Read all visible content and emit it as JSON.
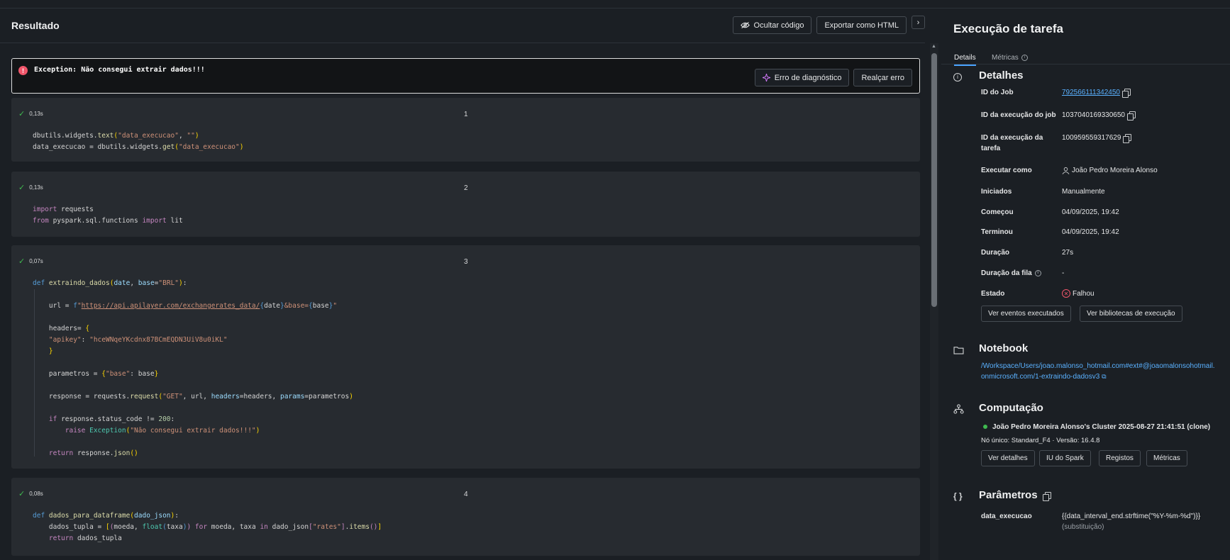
{
  "header": {
    "title": "Resultado",
    "hide_code": "Ocultar código",
    "export_html": "Exportar como HTML",
    "collapse": "›"
  },
  "error": {
    "icon": "!",
    "message": "Exception: Não consegui extrair dados!!!",
    "diagnose": "Erro de diagnóstico",
    "highlight": "Realçar erro"
  },
  "cells": [
    {
      "time": "0,13s",
      "num": "1"
    },
    {
      "time": "0,13s",
      "num": "2"
    },
    {
      "time": "0,07s",
      "num": "3"
    },
    {
      "time": "0,08s",
      "num": "4"
    }
  ],
  "panel": {
    "title": "Execução de tarefa",
    "tabs": [
      "Details",
      "Métricas"
    ],
    "details": {
      "title": "Detalhes",
      "job_id_label": "ID do Job",
      "job_id": "792566111342450",
      "job_run_label": "ID da execução do job",
      "job_run": "1037040169330650",
      "task_run_label_1": "ID da execução da",
      "task_run_label_2": "tarefa",
      "task_run": "100959559317629",
      "run_as_label": "Executar como",
      "run_as": "João Pedro Moreira Alonso",
      "started_by_label": "Iniciados",
      "started_by": "Manualmente",
      "start_label": "Começou",
      "start": "04/09/2025, 19:42",
      "end_label": "Terminou",
      "end": "04/09/2025, 19:42",
      "duration_label": "Duração",
      "duration": "27s",
      "queue_label": "Duração da fila",
      "queue": "-",
      "state_label": "Estado",
      "state": "Falhou",
      "btn_events": "Ver eventos executados",
      "btn_libs": "Ver bibliotecas de execução"
    },
    "notebook": {
      "title": "Notebook",
      "path_1": "/Workspace/Users/joao.malonso_hotmail.com#ext#@joaomalonsohotmail.",
      "path_2": "onmicrosoft.com/1-extraindo-dadosv3"
    },
    "compute": {
      "title": "Computação",
      "cluster": "João Pedro Moreira Alonso's Cluster 2025-08-27 21:41:51 (clone)",
      "node": "Nó único: Standard_F4 · Versão: 16.4.8",
      "btn_details": "Ver detalhes",
      "btn_spark": "IU do Spark",
      "btn_logs": "Registos",
      "btn_metrics": "Métricas"
    },
    "params": {
      "title": "Parâmetros",
      "icon": "{ }",
      "name": "data_execucao",
      "value": "{{data_interval_end.strftime(\"%Y-%m-%d\")}}",
      "note": "(substituição)"
    }
  },
  "colors": {
    "accent": "#4aa3ff",
    "error": "#f0566a",
    "success": "#3fb950",
    "bg": "#1b1f24",
    "cell": "#272b30"
  }
}
